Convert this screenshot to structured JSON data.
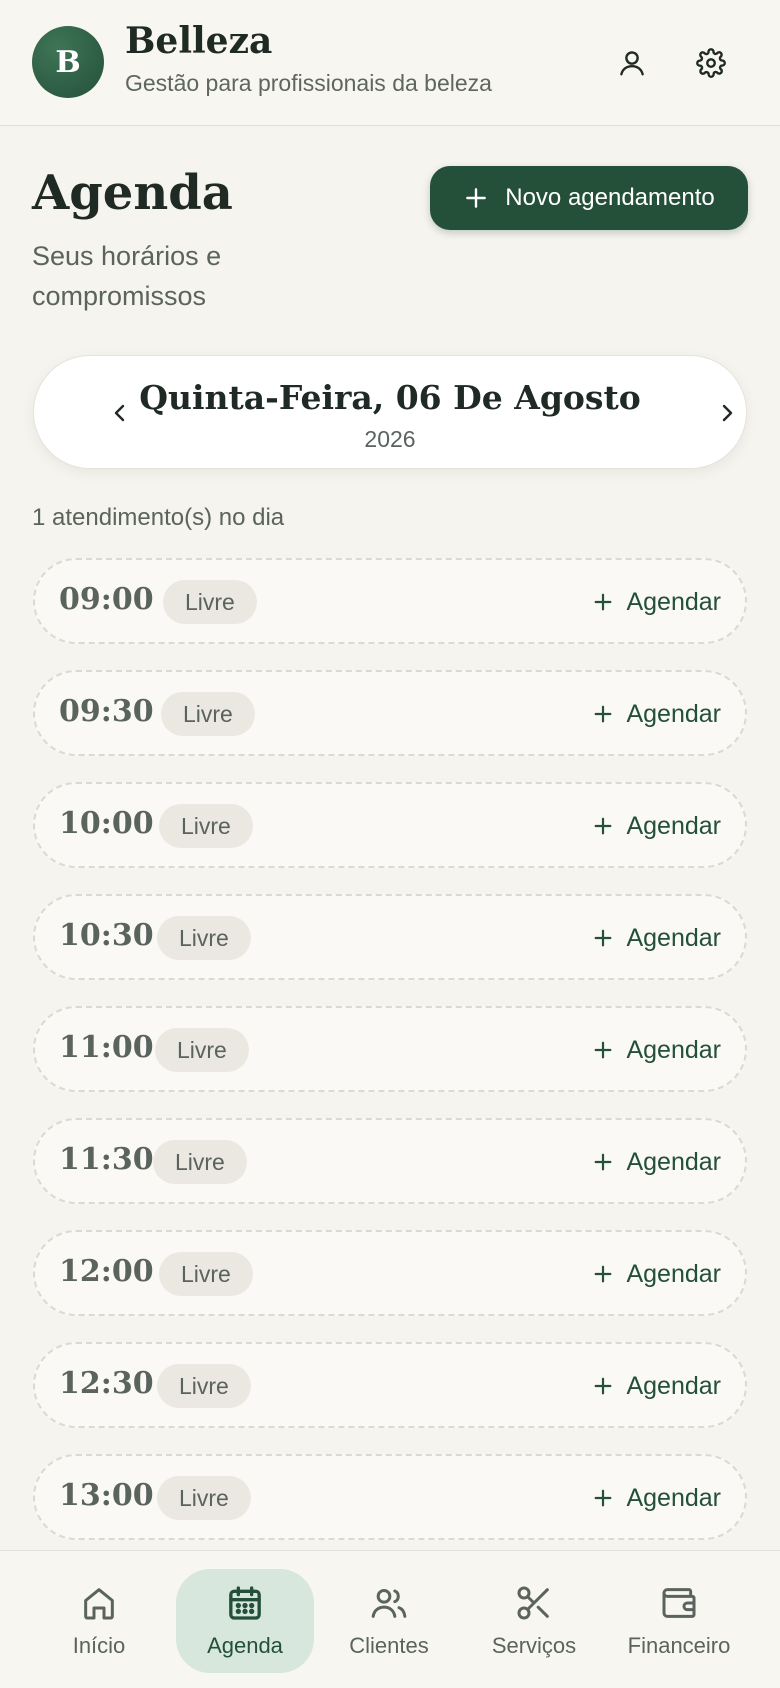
{
  "header": {
    "avatar_letter": "B",
    "title": "Belleza",
    "subtitle": "Gestão para profissionais da beleza",
    "profile_icon": "user-icon",
    "settings_icon": "gear-icon"
  },
  "page": {
    "title": "Agenda",
    "subtitle": "Seus horários e compromissos",
    "new_button_label": "Novo agendamento"
  },
  "date": {
    "main": "Quinta-Feira, 06 De Agosto",
    "year": "2026"
  },
  "count_text": "1 atendimento(s) no dia",
  "slots": [
    {
      "time": "09:00",
      "status": "Livre",
      "action": "Agendar"
    },
    {
      "time": "09:30",
      "status": "Livre",
      "action": "Agendar"
    },
    {
      "time": "10:00",
      "status": "Livre",
      "action": "Agendar"
    },
    {
      "time": "10:30",
      "status": "Livre",
      "action": "Agendar"
    },
    {
      "time": "11:00",
      "status": "Livre",
      "action": "Agendar"
    },
    {
      "time": "11:30",
      "status": "Livre",
      "action": "Agendar"
    },
    {
      "time": "12:00",
      "status": "Livre",
      "action": "Agendar"
    },
    {
      "time": "12:30",
      "status": "Livre",
      "action": "Agendar"
    },
    {
      "time": "13:00",
      "status": "Livre",
      "action": "Agendar"
    }
  ],
  "nav": [
    {
      "label": "Início",
      "icon": "home-icon"
    },
    {
      "label": "Agenda",
      "icon": "calendar-icon",
      "active": true
    },
    {
      "label": "Clientes",
      "icon": "users-icon"
    },
    {
      "label": "Serviços",
      "icon": "scissors-icon"
    },
    {
      "label": "Financeiro",
      "icon": "wallet-icon"
    }
  ],
  "colors": {
    "brand": "#24503a",
    "background": "#f6f4ee",
    "active_nav_bg": "#d7e7dd"
  }
}
